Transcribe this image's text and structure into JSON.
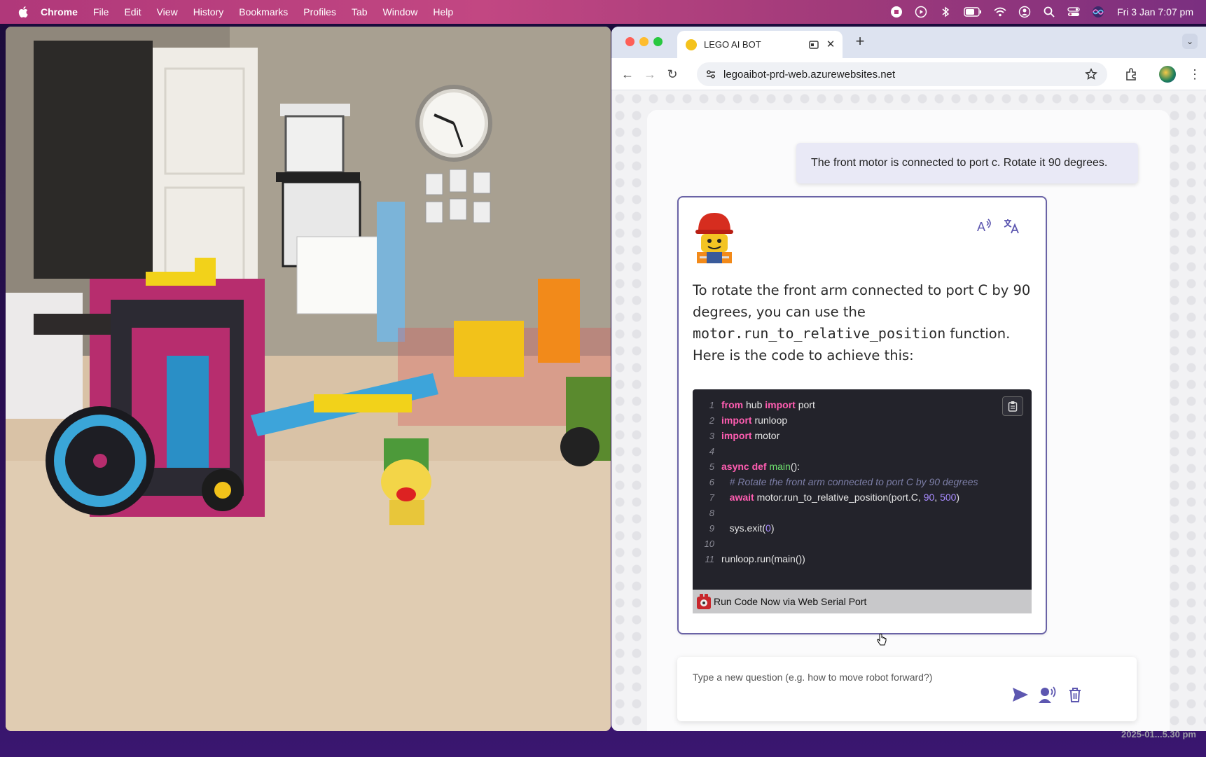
{
  "menubar": {
    "app_name": "Chrome",
    "items": [
      "File",
      "Edit",
      "View",
      "History",
      "Bookmarks",
      "Profiles",
      "Tab",
      "Window",
      "Help"
    ],
    "clock": "Fri 3 Jan  7:07 pm"
  },
  "browser": {
    "tab_title": "LEGO AI BOT",
    "url": "legoaibot-prd-web.azurewebsites.net"
  },
  "chat": {
    "user_message": "The front motor is connected to port c. Rotate it 90 degrees.",
    "bot_text_1": "To rotate the front arm connected to port C by 90 degrees, you can use the ",
    "bot_code_inline": "motor.run_to_relative_position",
    "bot_text_2": " function. Here is the code to achieve this:",
    "code": {
      "l1_kw1": "from",
      "l1_t1": " hub ",
      "l1_kw2": "import",
      "l1_t2": " port",
      "l2_kw1": "import",
      "l2_t1": " runloop",
      "l3_kw1": "import",
      "l3_t1": " motor",
      "l5_kw1": "async def",
      "l5_fn": " main",
      "l5_t1": "():",
      "l6_cm": "# Rotate the front arm connected to port C by 90 degrees",
      "l7_kw1": "await",
      "l7_t1": " motor.run_to_relative_position(port.C, ",
      "l7_n1": "90",
      "l7_t2": ", ",
      "l7_n2": "500",
      "l7_t3": ")",
      "l9_t1": "sys.exit(",
      "l9_n1": "0",
      "l9_t2": ")",
      "l11_t1": "runloop.run(main())",
      "line_numbers": [
        "1",
        "2",
        "3",
        "4",
        "5",
        "6",
        "7",
        "8",
        "9",
        "10",
        "11"
      ]
    },
    "run_button_label": "Run Code Now via Web Serial Port",
    "input_placeholder": "Type a new question (e.g. how to move robot forward?)"
  },
  "desktop": {
    "timestamp": "2025-01...5.30 pm"
  },
  "colors": {
    "menubar_accent": "#c24782",
    "card_border": "#6a63a6",
    "action_icons": "#5d57b0",
    "code_keyword": "#ff5db1",
    "code_function": "#6ee06e",
    "code_number": "#a88bff"
  },
  "icons": {
    "menubar_status": [
      "record-stop-icon",
      "play-icon",
      "bluetooth-icon",
      "battery-icon",
      "wifi-icon",
      "user-icon",
      "search-icon",
      "control-center-icon",
      "siri-icon"
    ],
    "chat_actions": [
      "read-aloud-icon",
      "translate-icon",
      "send-icon",
      "voice-input-icon",
      "trash-icon"
    ]
  }
}
